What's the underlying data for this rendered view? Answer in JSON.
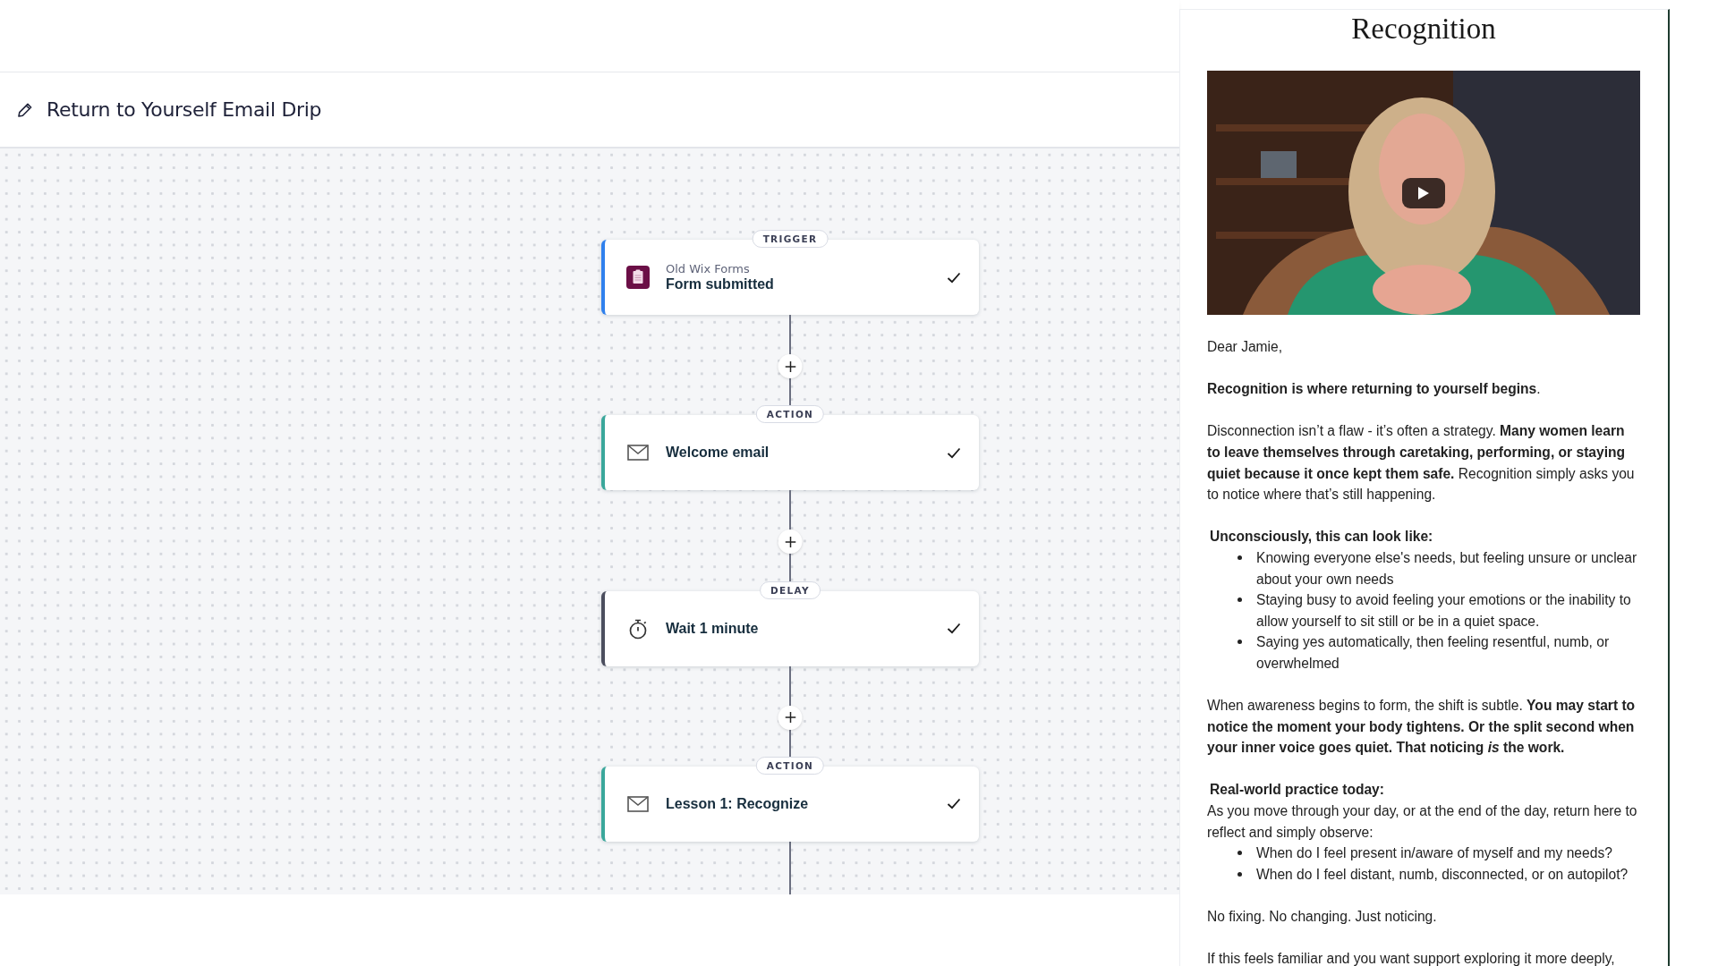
{
  "header": {
    "title": "Return to Yourself Email Drip"
  },
  "steps": [
    {
      "kind": "trigger",
      "badge": "TRIGGER",
      "app": "Old Wix Forms",
      "title": "Form submitted",
      "completed": true
    },
    {
      "kind": "action",
      "badge": "ACTION",
      "title": "Welcome email",
      "completed": true
    },
    {
      "kind": "delay",
      "badge": "DELAY",
      "title": "Wait 1 minute",
      "completed": true
    },
    {
      "kind": "action",
      "badge": "ACTION",
      "title": "Lesson 1: Recognize",
      "completed": true
    }
  ],
  "email_preview": {
    "title": "Recognition",
    "blocks": [
      {
        "kind": "paragraph",
        "text": "Dear Jamie,"
      },
      {
        "kind": "paragraph",
        "text": "**Recognition is where returning to yourself begins**."
      },
      {
        "kind": "paragraph",
        "text": "Disconnection isn’t a flaw - it’s often a strategy. **Many women learn to leave themselves through caretaking, performing, or staying quiet because it once kept them safe.** Recognition simply asks you to notice where that’s still happening."
      },
      {
        "kind": "heading",
        "text": "Unconsciously, this can look like:"
      },
      {
        "kind": "bullets",
        "items": [
          "Knowing everyone else's needs, but feeling unsure or unclear about your own needs",
          "Staying busy to avoid feeling your emotions or the inability to allow yourself to sit still or be in a quiet space.",
          "Saying yes automatically, then feeling resentful, numb, or overwhelmed"
        ]
      },
      {
        "kind": "paragraph",
        "text": "When awareness begins to form, the shift is subtle. **You may start to notice the moment your body tightens. Or the split second when your inner voice goes quiet. That noticing *is* the work.**"
      },
      {
        "kind": "heading",
        "text": "Real-world practice today:"
      },
      {
        "kind": "paragraph",
        "text": "As you move through your day, or at the end of the day, return here to reflect and simply observe:"
      },
      {
        "kind": "bullets",
        "items": [
          "When do I feel present in/aware of myself and my needs?",
          "When do I feel distant, numb, disconnected, or on autopilot?"
        ]
      },
      {
        "kind": "paragraph",
        "text": "No fixing. No changing. Just noticing."
      },
      {
        "kind": "paragraph",
        "text": "If this feels familiar and you want support exploring it more deeply,"
      }
    ]
  }
}
